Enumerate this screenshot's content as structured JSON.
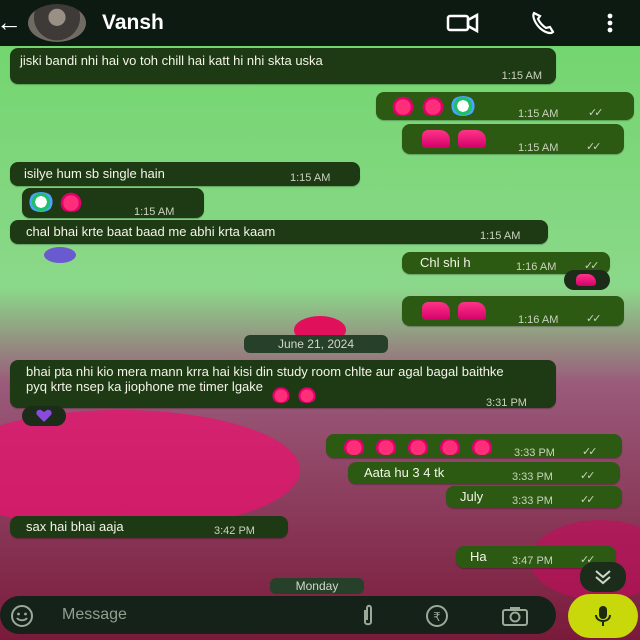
{
  "header": {
    "back_icon": "arrow-left-icon",
    "contact_name": "Vansh",
    "video_icon": "video-camera-icon",
    "call_icon": "phone-icon",
    "menu_icon": "vertical-dots-icon"
  },
  "messages": [
    {
      "dir": "in",
      "text": "jiski bandi nhi hai vo toh chill hai katt hi nhi skta uska",
      "time": "1:15 AM"
    },
    {
      "dir": "out",
      "emoji": "3 emoji",
      "time": "1:15 AM"
    },
    {
      "dir": "out",
      "emoji": "2 thumbs-up",
      "time": "1:15 AM"
    },
    {
      "dir": "in",
      "text": "isilye hum sb single hain",
      "time": "1:15 AM"
    },
    {
      "dir": "in",
      "emoji": "2 emoji",
      "time": "1:15 AM"
    },
    {
      "dir": "in",
      "text": "chal bhai krte baat baad me abhi krta kaam",
      "time": "1:15 AM"
    },
    {
      "dir": "out",
      "text": "Chl shi h",
      "time": "1:16 AM"
    },
    {
      "dir": "out",
      "emoji": "2 thumbs-up",
      "time": "1:16 AM"
    },
    {
      "dir": "in",
      "text": "bhai pta nhi kio mera mann krra hai kisi din study room chlte aur agal bagal baithke pyq krte nsep ka jiophone me timer lgake",
      "time": "3:31 PM"
    },
    {
      "dir": "out",
      "emoji": "5 emoji",
      "time": "3:33 PM"
    },
    {
      "dir": "out",
      "text": "Aata hu 3 4 tk",
      "time": "3:33 PM"
    },
    {
      "dir": "out",
      "text": "July",
      "time": "3:33 PM"
    },
    {
      "dir": "in",
      "text": "sax hai bhai aaja",
      "time": "3:42 PM"
    },
    {
      "dir": "out",
      "text": "Ha",
      "time": "3:47 PM"
    }
  ],
  "dates": {
    "d1": "June 21, 2024",
    "d2": "Monday"
  },
  "composer": {
    "placeholder": "Message",
    "emoji_icon": "emoji-smiley-icon",
    "attach_icon": "paperclip-icon",
    "payment_icon": "rupee-icon",
    "camera_icon": "camera-icon",
    "mic_icon": "microphone-icon"
  },
  "colors": {
    "header": "#0d1a12",
    "bubble_in": "#1e3a14",
    "bubble_out": "#2c5a12",
    "mic": "#c8d80a"
  }
}
